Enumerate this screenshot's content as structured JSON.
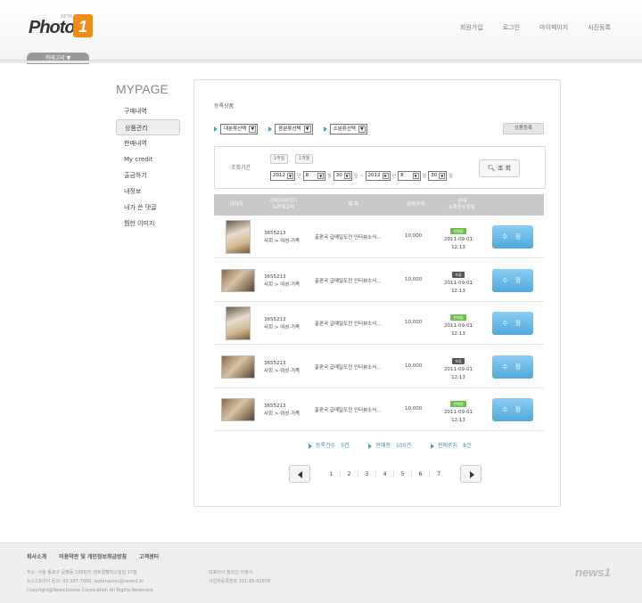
{
  "header": {
    "logo_text": "Photo",
    "logo_badge": "1",
    "logo_beta": "BETA",
    "nav": [
      "회원가입",
      "로그인",
      "마이페이지",
      "사진등록"
    ],
    "category_tab": "카테고리 ▼"
  },
  "sidebar": {
    "title": "MYPAGE",
    "items": [
      "구매내역",
      "상품관리",
      "판매내역",
      "My credit",
      "출금하기",
      "내정보",
      "내가 쓴 댓글",
      "찜한 이미지"
    ],
    "active_index": 1
  },
  "panel": {
    "title": "등록상품",
    "filters": [
      "대분류선택",
      "중분류선택",
      "소분류선택"
    ],
    "register_button": "상품등록",
    "period_label": "조회기간",
    "period_buttons": [
      "1주일",
      "1개월"
    ],
    "date_from": {
      "year": "2012",
      "month": "8",
      "day": "30"
    },
    "date_to": {
      "year": "2012",
      "month": "8",
      "day": "30"
    },
    "date_units": {
      "year": "년",
      "month": "월",
      "day": "일",
      "sep": "~"
    },
    "search_button": "조 회",
    "columns": [
      "이미지",
      "이미지아이디\n&카테고리",
      "제 목",
      "판매가격",
      "상태\n&최종수정일"
    ],
    "rows": [
      {
        "id": "3655213",
        "category": "사회 > 여성·가족",
        "title": "출판국 급매일도전 인터뷰소식...",
        "price": "10,000",
        "status": "판매중",
        "status_on": true,
        "date": "2011-09-01 12:13",
        "edit": "수 정",
        "thumb": "tall"
      },
      {
        "id": "3655213",
        "category": "사회 > 여성·가족",
        "title": "출판국 급매일도전 인터뷰소식...",
        "price": "10,000",
        "status": "보류",
        "status_on": false,
        "date": "2011-09-01 12:13",
        "edit": "수 정",
        "thumb": "wide"
      },
      {
        "id": "3655213",
        "category": "사회 > 여성·가족",
        "title": "출판국 급매일도전 인터뷰소식...",
        "price": "10,000",
        "status": "판매중",
        "status_on": true,
        "date": "2011-09-01 12:13",
        "edit": "수 정",
        "thumb": "tall"
      },
      {
        "id": "3655213",
        "category": "사회 > 여성·가족",
        "title": "출판국 급매일도전 인터뷰소식...",
        "price": "10,000",
        "status": "보류",
        "status_on": false,
        "date": "2011-09-01 12:13",
        "edit": "수 정",
        "thumb": "wide"
      },
      {
        "id": "3655213",
        "category": "사회 > 여성·가족",
        "title": "출판국 급매일도전 인터뷰소식...",
        "price": "10,000",
        "status": "판매중",
        "status_on": true,
        "date": "2011-09-01 12:13",
        "edit": "수 정",
        "thumb": "wide"
      }
    ],
    "summary": [
      {
        "label": "등록건수",
        "value": "5건"
      },
      {
        "label": "판매중",
        "value": "100건"
      },
      {
        "label": "판매중지",
        "value": "8건"
      }
    ],
    "pages": [
      "1",
      "2",
      "3",
      "4",
      "5",
      "6",
      "7"
    ]
  },
  "footer": {
    "nav": [
      "회사소개",
      "이용약관 및 개인정보취급방침",
      "고객센터"
    ],
    "info_left": [
      "주소: 서울 종로구 공평동 100번지 센트럴팰리스빌딩 17층",
      "뉴스1코리아 문의: 02-397-7000, webmaster@news1.kr",
      "Copyright@News1korea Corporation All Rights Reserved."
    ],
    "info_right": [
      "대표이사 홍성근 이영식",
      "사업자등록번호 101-86-62878"
    ],
    "logo": "news1"
  }
}
